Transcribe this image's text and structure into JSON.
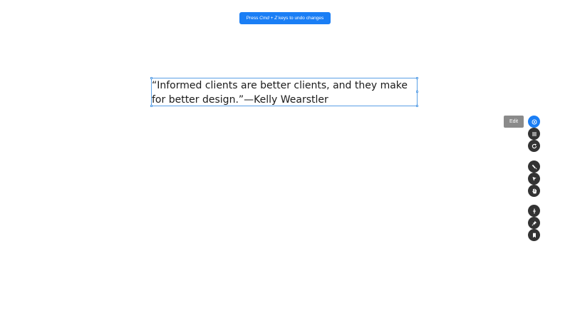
{
  "toast": {
    "prefix": "Press ",
    "keys": "Cmd + Z",
    "suffix": " keys to undo changes",
    "color": "#1a7ef5"
  },
  "quote": {
    "text": "“Informed clients are better clients, and they make for better design.”—Kelly Wearstler"
  },
  "tooltip": {
    "label": "Edit"
  },
  "toolbar": {
    "tools": [
      {
        "icon": "edit-icon",
        "active": true
      },
      {
        "icon": "align-text-icon",
        "active": false
      },
      {
        "icon": "redo-icon",
        "active": false
      },
      {
        "icon": "brush-icon",
        "active": false
      },
      {
        "icon": "pointer-icon",
        "active": false
      },
      {
        "icon": "hand-icon",
        "active": false
      },
      {
        "icon": "add-icon",
        "active": false
      },
      {
        "icon": "pin-icon",
        "active": false
      },
      {
        "icon": "bookmark-icon",
        "active": false
      }
    ],
    "accent": "#1a7ef5",
    "button_color": "#333333"
  }
}
